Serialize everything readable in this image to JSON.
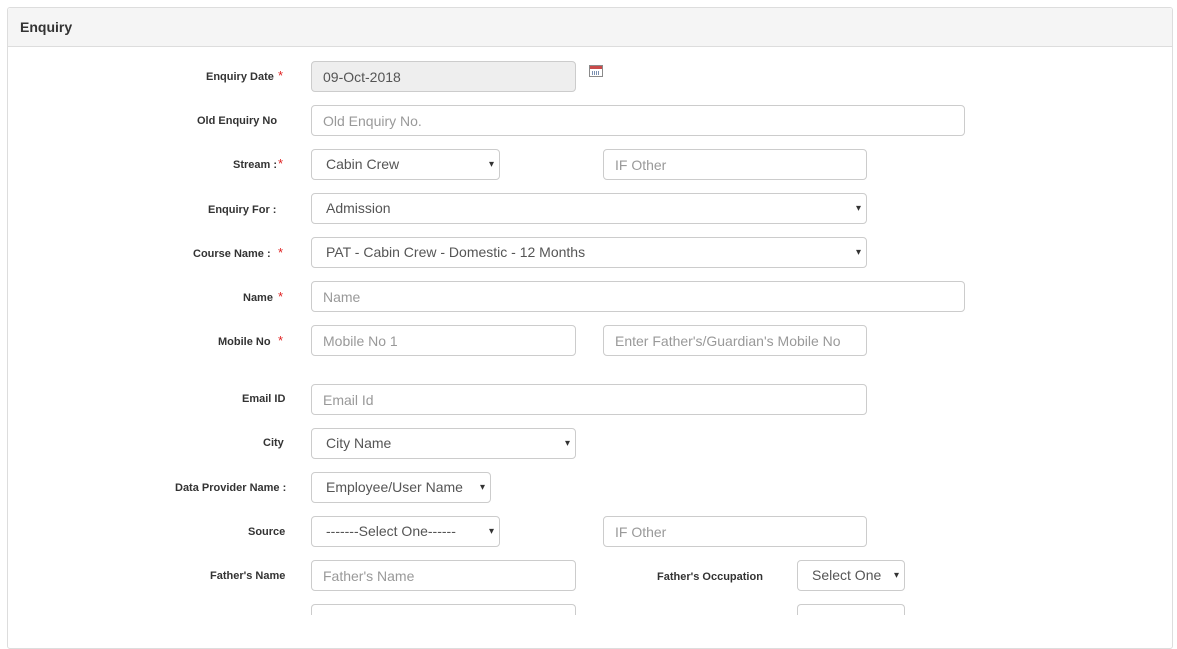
{
  "panel": {
    "title": "Enquiry"
  },
  "fields": {
    "enquiry_date": {
      "label": "Enquiry Date",
      "required_mark": "*",
      "value": "09-Oct-2018"
    },
    "old_enquiry_no": {
      "label": "Old Enquiry No",
      "placeholder": "Old Enquiry No."
    },
    "stream": {
      "label": "Stream :",
      "required_mark": "*",
      "selected": "Cabin Crew",
      "other_placeholder": "IF Other"
    },
    "enquiry_for": {
      "label": "Enquiry For :",
      "selected": "Admission"
    },
    "course_name": {
      "label": "Course Name :",
      "required_mark": "*",
      "selected": "PAT - Cabin Crew - Domestic - 12 Months"
    },
    "name": {
      "label": "Name",
      "required_mark": "*",
      "placeholder": "Name"
    },
    "mobile_no": {
      "label": "Mobile No",
      "required_mark": "*",
      "placeholder": "Mobile No 1",
      "guardian_placeholder": "Enter Father's/Guardian's Mobile No"
    },
    "email_id": {
      "label": "Email ID",
      "placeholder": "Email Id"
    },
    "city": {
      "label": "City",
      "selected": "City Name"
    },
    "data_provider_name": {
      "label": "Data Provider Name :",
      "selected": "Employee/User Name"
    },
    "source": {
      "label": "Source",
      "selected": "-------Select One------",
      "other_placeholder": "IF Other"
    },
    "fathers_name": {
      "label": "Father's Name",
      "placeholder": "Father's Name"
    },
    "fathers_occupation": {
      "label": "Father's Occupation",
      "selected": "Select One"
    }
  },
  "icons": {
    "calendar": "calendar-icon",
    "dropdown": "chevron-down-icon",
    "caret_glyph": "▾"
  },
  "colors": {
    "required": "#e02222",
    "header_bg": "#f5f5f5",
    "readonly_bg": "#eeeeee",
    "border": "#cccccc"
  }
}
